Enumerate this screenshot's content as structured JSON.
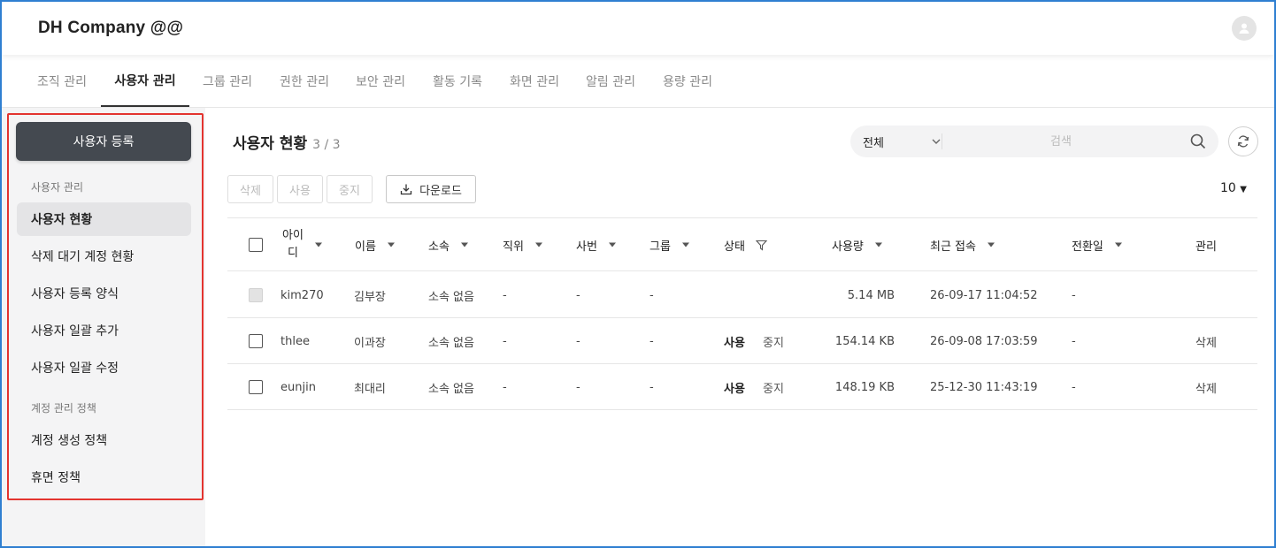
{
  "header": {
    "company": "DH Company @@"
  },
  "tabs": [
    {
      "label": "조직 관리"
    },
    {
      "label": "사용자 관리"
    },
    {
      "label": "그룹 관리"
    },
    {
      "label": "권한 관리"
    },
    {
      "label": "보안 관리"
    },
    {
      "label": "활동 기록"
    },
    {
      "label": "화면 관리"
    },
    {
      "label": "알림 관리"
    },
    {
      "label": "용량 관리"
    }
  ],
  "sidebar": {
    "register_button": "사용자 등록",
    "section1": "사용자 관리",
    "items": [
      {
        "label": "사용자 현황"
      },
      {
        "label": "삭제 대기 계정 현황"
      },
      {
        "label": "사용자 등록 양식"
      },
      {
        "label": "사용자 일괄 추가"
      },
      {
        "label": "사용자 일괄 수정"
      }
    ],
    "section2": "계정 관리 정책",
    "items2": [
      {
        "label": "계정 생성 정책"
      },
      {
        "label": "휴면 정책"
      }
    ]
  },
  "main": {
    "title": "사용자 현황",
    "count": "3 / 3",
    "search_scope": "전체",
    "search_placeholder": "검색",
    "actions": {
      "delete": "삭제",
      "use": "사용",
      "stop": "중지",
      "download": "다운로드"
    },
    "page_size": "10"
  },
  "table": {
    "headers": {
      "id_line1": "아이",
      "id_line2": "디",
      "name": "이름",
      "dept": "소속",
      "position": "직위",
      "empno": "사번",
      "group": "그룹",
      "status": "상태",
      "usage": "사용량",
      "last_access": "최근 접속",
      "converted": "전환일",
      "manage": "관리"
    },
    "rows": [
      {
        "id": "kim270",
        "name": "김부장",
        "dept": "소속 없음",
        "position": "-",
        "empno": "-",
        "group": "-",
        "status_on": "",
        "status_off": "",
        "usage": "5.14 MB",
        "last_access": "26-09-17 11:04:52",
        "converted": "-",
        "manage": ""
      },
      {
        "id": "thlee",
        "name": "이과장",
        "dept": "소속 없음",
        "position": "-",
        "empno": "-",
        "group": "-",
        "status_on": "사용",
        "status_off": "중지",
        "usage": "154.14 KB",
        "last_access": "26-09-08 17:03:59",
        "converted": "-",
        "manage": "삭제"
      },
      {
        "id": "eunjin",
        "name": "최대리",
        "dept": "소속 없음",
        "position": "-",
        "empno": "-",
        "group": "-",
        "status_on": "사용",
        "status_off": "중지",
        "usage": "148.19 KB",
        "last_access": "25-12-30 11:43:19",
        "converted": "-",
        "manage": "삭제"
      }
    ]
  },
  "colors": {
    "accent_dark": "#444950",
    "highlight_border": "#e3342f",
    "frame": "#2f7fd1"
  }
}
